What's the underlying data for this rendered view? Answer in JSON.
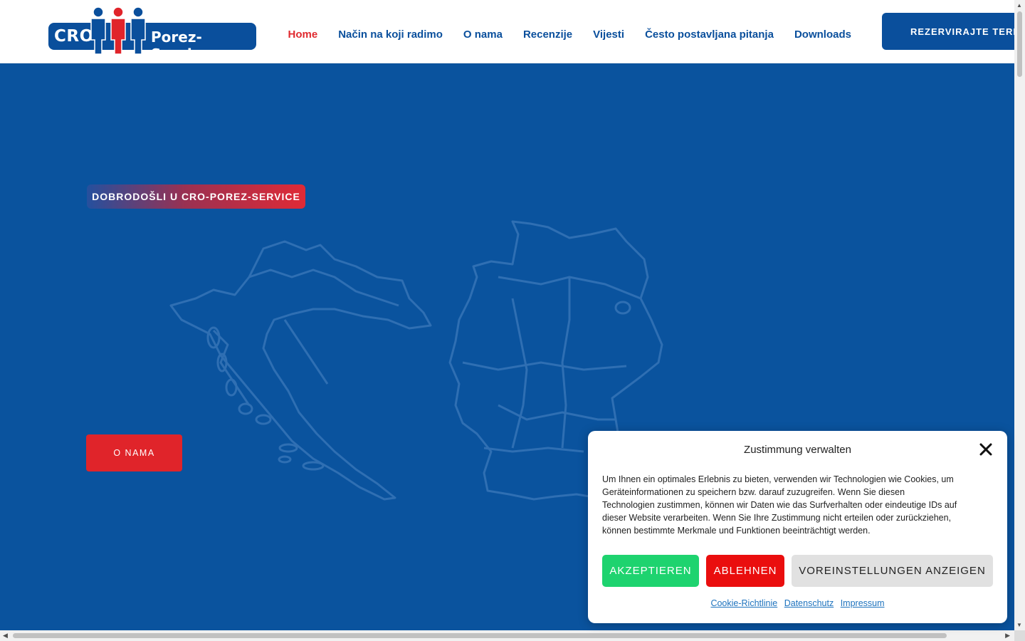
{
  "header": {
    "logo": {
      "left_text": "CRO",
      "right_text": "Porez-Service"
    },
    "nav": [
      {
        "label": "Home",
        "active": true
      },
      {
        "label": "Način na koji radimo",
        "active": false
      },
      {
        "label": "O nama",
        "active": false
      },
      {
        "label": "Recenzije",
        "active": false
      },
      {
        "label": "Vijesti",
        "active": false
      },
      {
        "label": "Često postavljana pitanja",
        "active": false
      },
      {
        "label": "Downloads",
        "active": false
      }
    ],
    "cta_label": "REZERVIRAJTE TERMIN"
  },
  "hero": {
    "badge": "DOBRODOŠLI U CRO-POREZ-SERVICE",
    "button_label": "O NAMA",
    "background_color": "#0a539e"
  },
  "cookie": {
    "title": "Zustimmung verwalten",
    "text": "Um Ihnen ein optimales Erlebnis zu bieten, verwenden wir Technologien wie Cookies, um Geräteinformationen zu speichern bzw. darauf zuzugreifen. Wenn Sie diesen Technologien zustimmen, können wir Daten wie das Surfverhalten oder eindeutige IDs auf dieser Website verarbeiten. Wenn Sie Ihre Zustimmung nicht erteilen oder zurückziehen, können bestimmte Merkmale und Funktionen beeinträchtigt werden.",
    "accept": "AKZEPTIEREN",
    "deny": "ABLEHNEN",
    "preferences": "VOREINSTELLUNGEN ANZEIGEN",
    "links": [
      "Cookie-Richtlinie",
      "Datenschutz",
      "Impressum"
    ]
  },
  "colors": {
    "brand_blue": "#0a4f9c",
    "brand_red": "#e02a2f",
    "accept_green": "#1ed36f"
  }
}
